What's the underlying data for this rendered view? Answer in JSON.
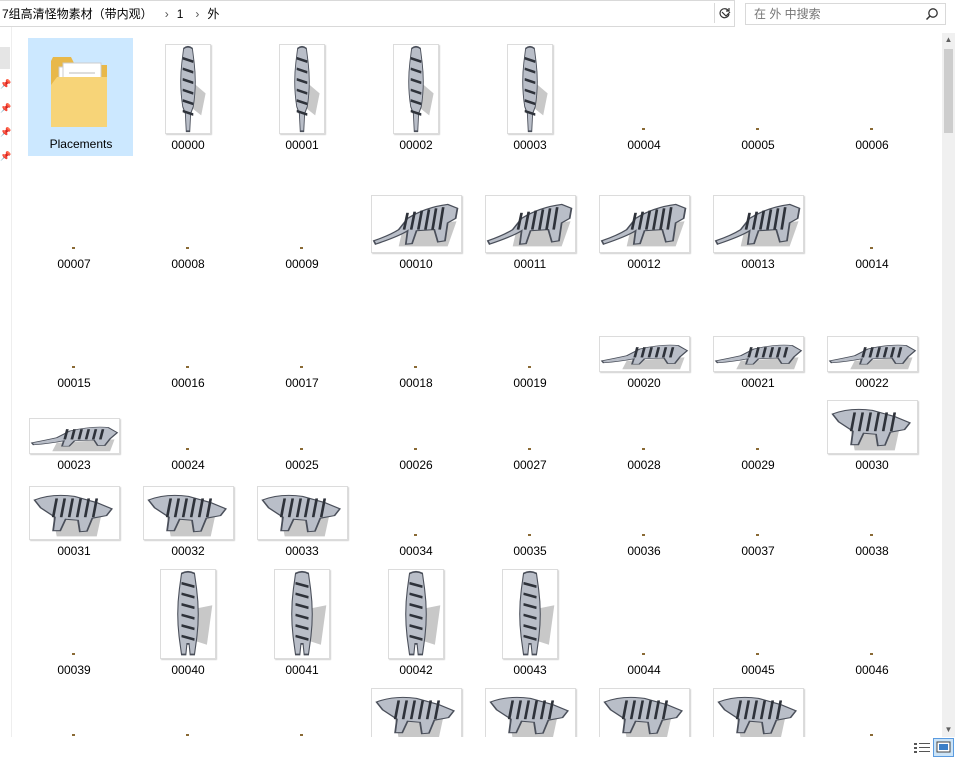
{
  "breadcrumb": {
    "items": [
      "7组高清怪物素材（带内观）",
      "1",
      "外"
    ]
  },
  "search": {
    "placeholder": "在 外 中搜索"
  },
  "folder": {
    "name": "Placements"
  },
  "files": [
    {
      "name": "00000",
      "pose": "front-down"
    },
    {
      "name": "00001",
      "pose": "front-down"
    },
    {
      "name": "00002",
      "pose": "front-down"
    },
    {
      "name": "00003",
      "pose": "front-down"
    },
    {
      "name": "00004",
      "pose": "empty"
    },
    {
      "name": "00005",
      "pose": "empty"
    },
    {
      "name": "00006",
      "pose": "empty"
    },
    {
      "name": "00007",
      "pose": "empty"
    },
    {
      "name": "00008",
      "pose": "empty"
    },
    {
      "name": "00009",
      "pose": "empty"
    },
    {
      "name": "00010",
      "pose": "side-walk"
    },
    {
      "name": "00011",
      "pose": "side-walk"
    },
    {
      "name": "00012",
      "pose": "side-walk"
    },
    {
      "name": "00013",
      "pose": "side-walk"
    },
    {
      "name": "00014",
      "pose": "empty"
    },
    {
      "name": "00015",
      "pose": "empty"
    },
    {
      "name": "00016",
      "pose": "empty"
    },
    {
      "name": "00017",
      "pose": "empty"
    },
    {
      "name": "00018",
      "pose": "empty"
    },
    {
      "name": "00019",
      "pose": "empty"
    },
    {
      "name": "00020",
      "pose": "side-low"
    },
    {
      "name": "00021",
      "pose": "side-low"
    },
    {
      "name": "00022",
      "pose": "side-low"
    },
    {
      "name": "00023",
      "pose": "side-low"
    },
    {
      "name": "00024",
      "pose": "empty"
    },
    {
      "name": "00025",
      "pose": "empty"
    },
    {
      "name": "00026",
      "pose": "empty"
    },
    {
      "name": "00027",
      "pose": "empty"
    },
    {
      "name": "00028",
      "pose": "empty"
    },
    {
      "name": "00029",
      "pose": "empty"
    },
    {
      "name": "00030",
      "pose": "three-quarter"
    },
    {
      "name": "00031",
      "pose": "three-quarter"
    },
    {
      "name": "00032",
      "pose": "three-quarter"
    },
    {
      "name": "00033",
      "pose": "three-quarter"
    },
    {
      "name": "00034",
      "pose": "empty"
    },
    {
      "name": "00035",
      "pose": "empty"
    },
    {
      "name": "00036",
      "pose": "empty"
    },
    {
      "name": "00037",
      "pose": "empty"
    },
    {
      "name": "00038",
      "pose": "empty"
    },
    {
      "name": "00039",
      "pose": "empty"
    },
    {
      "name": "00040",
      "pose": "front-up"
    },
    {
      "name": "00041",
      "pose": "front-up"
    },
    {
      "name": "00042",
      "pose": "front-up"
    },
    {
      "name": "00043",
      "pose": "front-up"
    },
    {
      "name": "00044",
      "pose": "empty"
    },
    {
      "name": "00045",
      "pose": "empty"
    },
    {
      "name": "00046",
      "pose": "empty"
    }
  ],
  "partial_row": [
    "empty",
    "empty",
    "empty",
    "three-quarter",
    "three-quarter",
    "three-quarter",
    "three-quarter",
    "empty"
  ],
  "colors": {
    "selection": "#cce8ff",
    "label": "#000000",
    "thumb_border": "#dcdcdc"
  }
}
